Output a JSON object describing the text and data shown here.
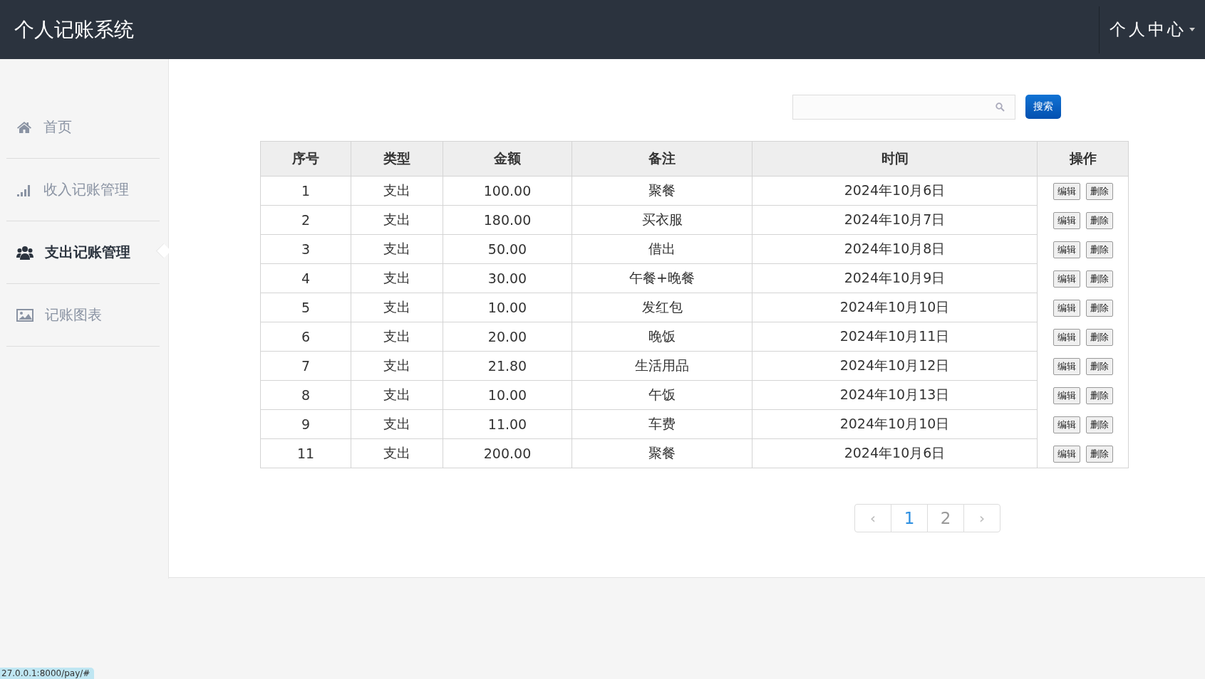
{
  "header": {
    "title": "个人记账系统",
    "user_menu": "个人中心"
  },
  "sidebar": {
    "items": [
      {
        "label": "首页",
        "selected": false
      },
      {
        "label": "收入记账管理",
        "selected": false
      },
      {
        "label": "支出记账管理",
        "selected": true
      },
      {
        "label": "记账图表",
        "selected": false
      }
    ]
  },
  "search": {
    "button": "搜索"
  },
  "table": {
    "columns": [
      "序号",
      "类型",
      "金额",
      "备注",
      "时间",
      "操作"
    ],
    "rows": [
      {
        "cells": [
          "1",
          "支出",
          "100.00",
          "聚餐",
          "2024年10月6日"
        ],
        "actions": [
          "编辑",
          "删除"
        ]
      },
      {
        "cells": [
          "2",
          "支出",
          "180.00",
          "买衣服",
          "2024年10月7日"
        ],
        "actions": [
          "编辑",
          "删除"
        ]
      },
      {
        "cells": [
          "3",
          "支出",
          "50.00",
          "借出",
          "2024年10月8日"
        ],
        "actions": [
          "编辑",
          "删除"
        ]
      },
      {
        "cells": [
          "4",
          "支出",
          "30.00",
          "午餐+晚餐",
          "2024年10月9日"
        ],
        "actions": [
          "编辑",
          "删除"
        ]
      },
      {
        "cells": [
          "5",
          "支出",
          "10.00",
          "发红包",
          "2024年10月10日"
        ],
        "actions": [
          "编辑",
          "删除"
        ]
      },
      {
        "cells": [
          "6",
          "支出",
          "20.00",
          "晚饭",
          "2024年10月11日"
        ],
        "actions": [
          "编辑",
          "删除"
        ]
      },
      {
        "cells": [
          "7",
          "支出",
          "21.80",
          "生活用品",
          "2024年10月12日"
        ],
        "actions": [
          "编辑",
          "删除"
        ]
      },
      {
        "cells": [
          "8",
          "支出",
          "10.00",
          "午饭",
          "2024年10月13日"
        ],
        "actions": [
          "编辑",
          "删除"
        ]
      },
      {
        "cells": [
          "9",
          "支出",
          "11.00",
          "车费",
          "2024年10月10日"
        ],
        "actions": [
          "编辑",
          "删除"
        ]
      },
      {
        "cells": [
          "11",
          "支出",
          "200.00",
          "聚餐",
          "2024年10月6日"
        ],
        "actions": [
          "编辑",
          "删除"
        ]
      }
    ]
  },
  "pagination": {
    "prev": "‹",
    "next": "›",
    "pages": [
      {
        "label": "1",
        "selected": true
      },
      {
        "label": "2",
        "selected": false
      }
    ]
  },
  "status_bar": {
    "url": "27.0.0.1:8000/pay/#"
  }
}
